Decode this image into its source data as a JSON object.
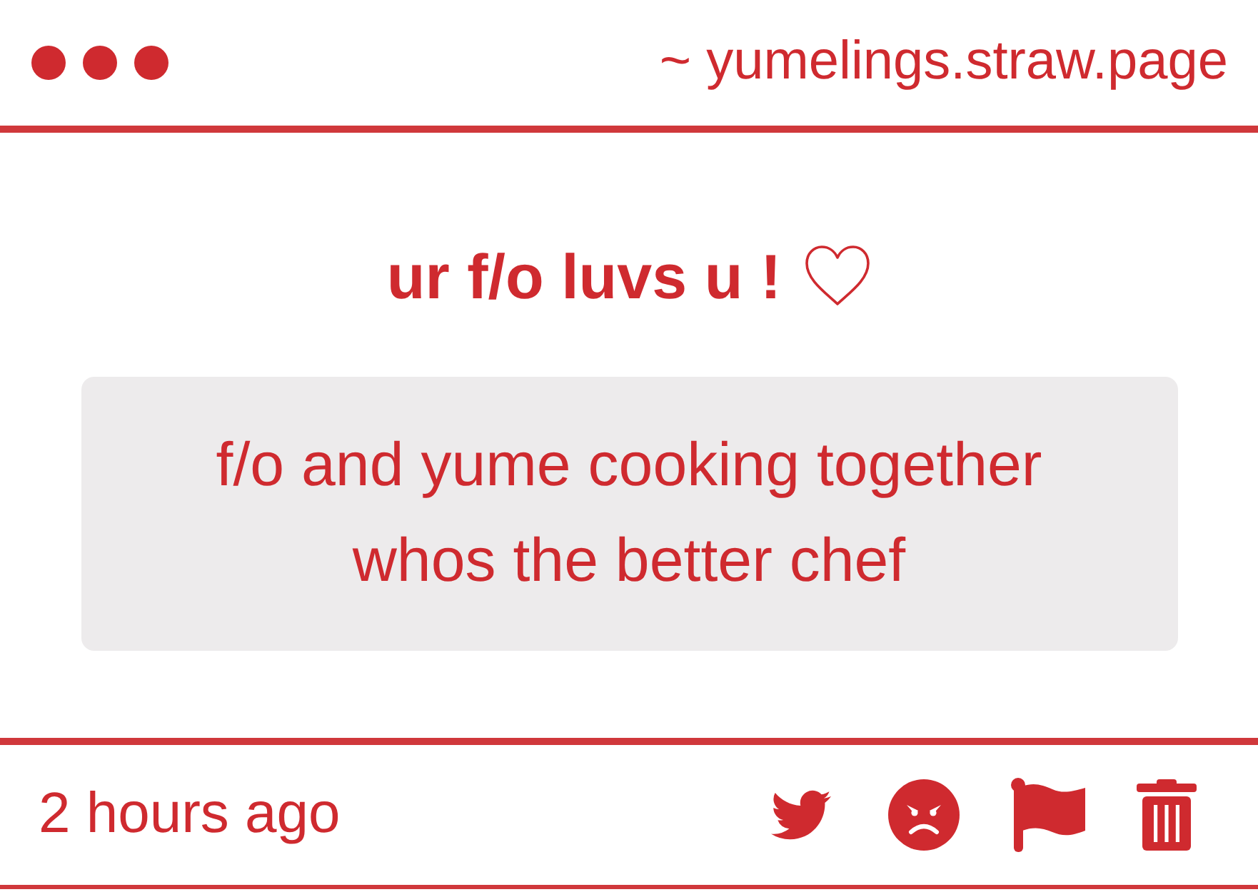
{
  "header": {
    "domain": "~ yumelings.straw.page"
  },
  "card": {
    "title": "ur f/o luvs u !",
    "message": "f/o and yume cooking together\nwhos the better chef"
  },
  "footer": {
    "timestamp": "2 hours ago",
    "actions": [
      {
        "kind": "twitter"
      },
      {
        "kind": "angry"
      },
      {
        "kind": "flag"
      },
      {
        "kind": "delete"
      }
    ]
  }
}
